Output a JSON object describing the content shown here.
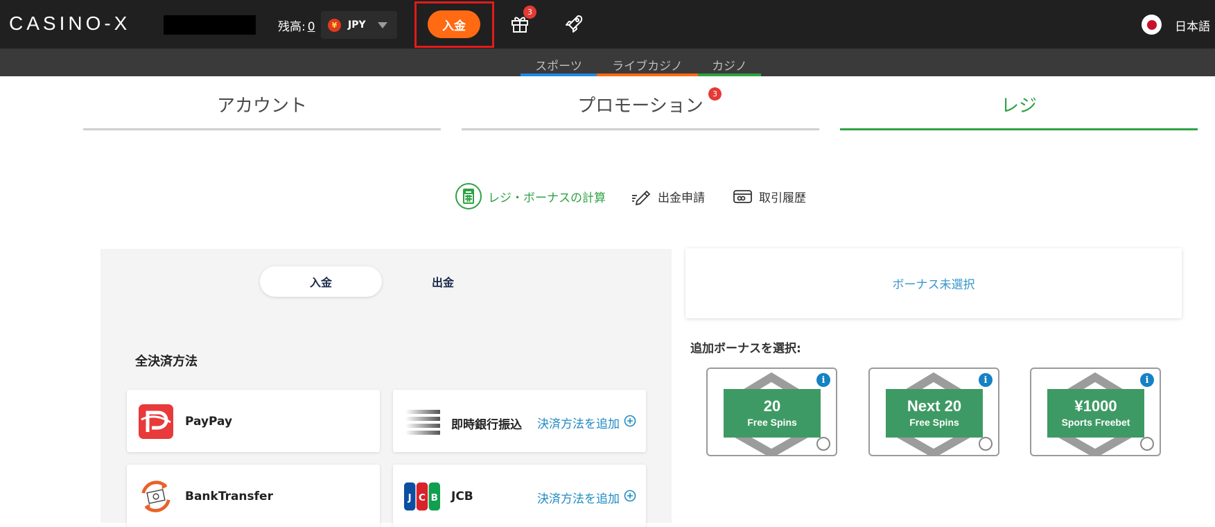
{
  "header": {
    "logo": "CASINO-X",
    "balance_label": "残高:",
    "balance_value": "0",
    "currency_symbol": "¥",
    "currency": "JPY",
    "deposit_button": "入金",
    "gift_badge": "3",
    "language": "日本語"
  },
  "subnav": {
    "items": [
      {
        "label": "スポーツ",
        "color": "#1e88e5"
      },
      {
        "label": "ライブカジノ",
        "color": "#ff6a13"
      },
      {
        "label": "カジノ",
        "color": "#2ea243"
      }
    ]
  },
  "tabs": {
    "account": "アカウント",
    "promotion": "プロモーション",
    "promotion_badge": "3",
    "cashier": "レジ"
  },
  "subtabs": {
    "calc": "レジ・ボーナスの計算",
    "withdraw_request": "出金申請",
    "history": "取引履歴"
  },
  "cashier": {
    "toggle_deposit": "入金",
    "toggle_withdraw": "出金",
    "section_title": "全決済方法",
    "methods": [
      {
        "name": "PayPay",
        "add": ""
      },
      {
        "name": "即時銀行振込",
        "add": "決済方法を追加"
      },
      {
        "name": "BankTransfer",
        "add": ""
      },
      {
        "name": "JCB",
        "add": "決済方法を追加"
      }
    ]
  },
  "bonus": {
    "none_selected": "ボーナス未選択",
    "add_title": "追加ボーナスを選択:",
    "cards": [
      {
        "big": "20",
        "small": "Free Spins"
      },
      {
        "big": "Next 20",
        "small": "Free Spins"
      },
      {
        "big": "¥1000",
        "small": "Sports Freebet"
      }
    ]
  },
  "colors": {
    "accent_green": "#2ea243",
    "deposit_orange": "#ff6a13",
    "highlight_red": "#e21b1b",
    "link_blue": "#1e8bc3"
  }
}
